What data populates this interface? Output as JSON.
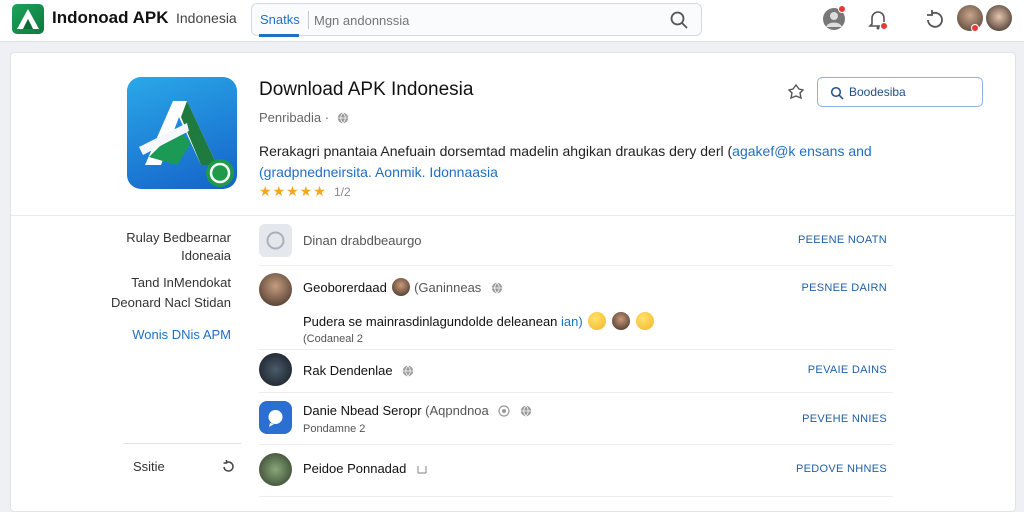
{
  "header": {
    "app_name": "Indonoad APK",
    "region": "Indonesia",
    "search_tab": "Snatks",
    "search_placeholder": "Mgn andonnssia"
  },
  "app": {
    "title": "Download APK Indonesia",
    "subtitle": "Penribadia ·",
    "description_plain": "Rerakagri pnantaia Anefuain dorsemtad madelin ahgikan draukas dery derl (",
    "description_link_inline": "agakef@k ensans and",
    "description_link_line2": "(gradpnedneirsita. Aonmik. Idonnaasia",
    "rating_stars": "★★★★★",
    "rating_value": 4.5,
    "rating_count": "1/2",
    "action_button": "Boodesiba"
  },
  "sidebar": {
    "items": [
      {
        "label": "Rulay Bedbearnar"
      },
      {
        "label": "Idoneaia"
      },
      {
        "label": "Tand InMendokat"
      },
      {
        "label": "Deonard Nacl Stidan"
      },
      {
        "label": "Wonis DNis APM"
      }
    ],
    "settings": "Ssitie"
  },
  "rows": [
    {
      "title": "Dinan drabdbeaurgo",
      "sub": "",
      "action": "PEEENE NOATN"
    },
    {
      "title": "Geoborerdaad",
      "tag": "(Ganinneas",
      "sub": "",
      "action": "PESNEE DAIRN"
    },
    {
      "title": "Pudera se mainrasdinlagundolde deleanean",
      "tag": "ian)",
      "sub": "(Codaneal 2",
      "action": ""
    },
    {
      "title": "Rak Dendenlae",
      "sub": "",
      "action": "PEVAIE DAINS"
    },
    {
      "title": "Danie Nbead Seropr",
      "tag": "(Aqpndnoa",
      "sub": "Pondamne 2",
      "action": "PEVEHE NNIES"
    },
    {
      "title": "Peidoe Ponnadad",
      "sub": "",
      "action": "PEDOVE NHNES"
    }
  ],
  "colors": {
    "accent": "#1f6fc6",
    "star": "#f4a623",
    "badge": "#e53935",
    "logo_green": "#1ba35a",
    "app_icon_blue": "#1562c9"
  },
  "icons": [
    "logo-icon",
    "search-icon",
    "user-icon",
    "bell-icon",
    "refresh-icon",
    "share-icon",
    "globe-icon",
    "app-icon"
  ]
}
